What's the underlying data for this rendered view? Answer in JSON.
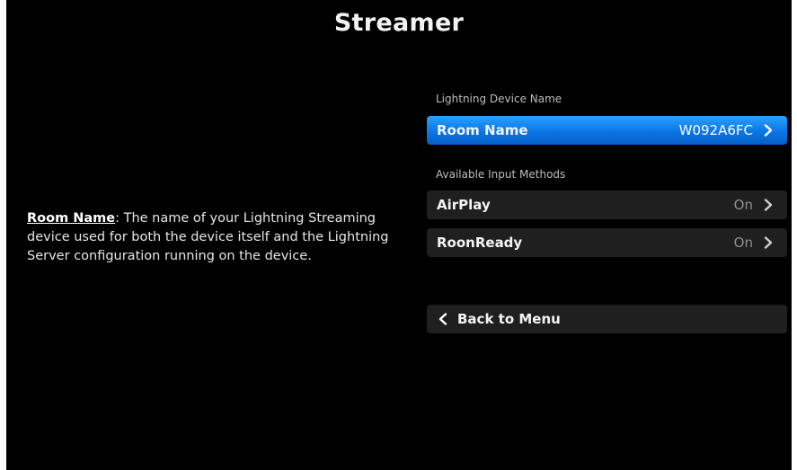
{
  "header": {
    "title": "Streamer"
  },
  "help": {
    "term": "Room Name",
    "text": ": The name of your Lightning Streaming device used for both the device itself and the Lightning Server configuration running on the device."
  },
  "sections": {
    "device_name_label": "Lightning Device Name",
    "input_methods_label": "Available Input Methods"
  },
  "rows": {
    "room_name": {
      "label": "Room Name",
      "value": "W092A6FC"
    },
    "airplay": {
      "label": "AirPlay",
      "value": "On"
    },
    "roonready": {
      "label": "RoonReady",
      "value": "On"
    }
  },
  "nav": {
    "back_label": "Back to Menu"
  },
  "icons": {
    "row_chevron": "chevron-right-icon",
    "back_chevron": "chevron-left-icon"
  },
  "colors": {
    "background": "#000000",
    "selected_row": "#0a76e6",
    "row": "#1f1f1f",
    "muted_value": "#8f8f8f"
  }
}
